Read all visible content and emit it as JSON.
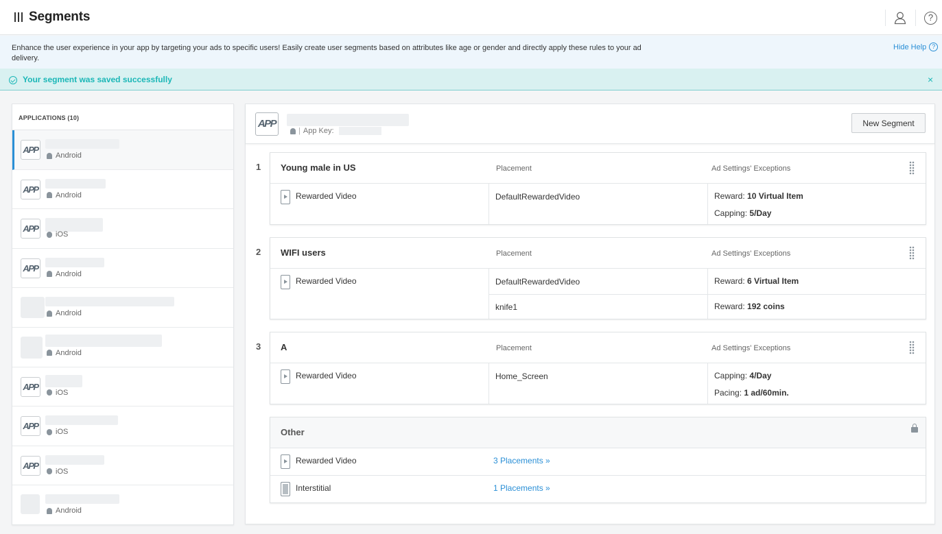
{
  "header": {
    "title": "Segments"
  },
  "help": {
    "text": "Enhance the user experience in your app by targeting your ads to specific users! Easily create user segments based on attributes like age or gender and directly apply these rules to your ad delivery.",
    "hide_label": "Hide Help",
    "hide_icon_glyph": "?"
  },
  "success": {
    "text": "Your segment was saved successfully",
    "close_glyph": "×"
  },
  "sidebar": {
    "header": "APPLICATIONS (10)",
    "items": [
      {
        "platform": "Android"
      },
      {
        "platform": "Android"
      },
      {
        "platform": "iOS"
      },
      {
        "platform": "Android"
      },
      {
        "platform": "Android"
      },
      {
        "platform": "Android"
      },
      {
        "platform": "iOS"
      },
      {
        "platform": "iOS"
      },
      {
        "platform": "iOS"
      },
      {
        "platform": "Android"
      }
    ]
  },
  "main": {
    "logo_text": "APP",
    "app_key_label": "App Key:",
    "new_segment_label": "New Segment",
    "col_placement": "Placement",
    "col_exceptions": "Ad Settings' Exceptions",
    "segments": [
      {
        "number": "1",
        "title": "Young male in US",
        "ad_type": "Rewarded Video",
        "placements": [
          "DefaultRewardedVideo"
        ],
        "exceptions": [
          {
            "label": "Reward:",
            "value": "10 Virtual Item"
          },
          {
            "label": "Capping:",
            "value": "5/Day"
          }
        ]
      },
      {
        "number": "2",
        "title": "WIFI users",
        "ad_type": "Rewarded Video",
        "placements": [
          "DefaultRewardedVideo",
          "knife1"
        ],
        "exceptions": [
          {
            "label": "Reward:",
            "value": "6 Virtual Item"
          },
          {
            "label": "Reward:",
            "value": "192 coins"
          }
        ]
      },
      {
        "number": "3",
        "title": "A",
        "ad_type": "Rewarded Video",
        "placements": [
          "Home_Screen"
        ],
        "exceptions": [
          {
            "label": "Capping:",
            "value": "4/Day"
          },
          {
            "label": "Pacing:",
            "value": "1 ad/60min."
          }
        ]
      }
    ],
    "other": {
      "title": "Other",
      "rows": [
        {
          "ad_type": "Rewarded Video",
          "link": "3 Placements »"
        },
        {
          "ad_type": "Interstitial",
          "link": "1 Placements »"
        }
      ]
    }
  }
}
